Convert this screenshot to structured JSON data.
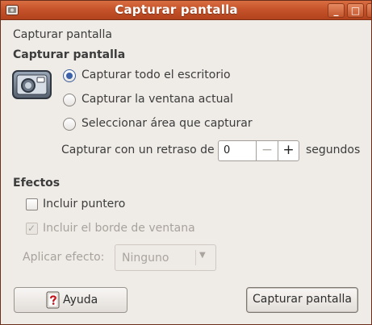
{
  "window": {
    "title": "Capturar pantalla",
    "minimize_label": "_",
    "maximize_label": "□"
  },
  "header_caption": "Capturar pantalla",
  "capture_section": {
    "heading": "Capturar pantalla",
    "options": [
      {
        "label": "Capturar todo el escritorio",
        "checked": true
      },
      {
        "label": "Capturar la ventana actual",
        "checked": false
      },
      {
        "label": "Seleccionar área que capturar",
        "checked": false
      }
    ],
    "delay_label": "Capturar con un retraso de",
    "delay_value": "0",
    "delay_unit": "segundos",
    "minus_label": "−",
    "plus_label": "+"
  },
  "effects_section": {
    "heading": "Efectos",
    "include_pointer": {
      "label": "Incluir puntero",
      "checked": false
    },
    "include_border": {
      "label": "Incluir el borde de ventana",
      "checked": true,
      "disabled": true
    },
    "apply_effect_label": "Aplicar efecto:",
    "apply_effect_value": "Ninguno"
  },
  "buttons": {
    "help_label": "Ayuda",
    "capture_label": "Capturar pantalla"
  },
  "colors": {
    "titlebar": "#c6532a",
    "radio_accent": "#3b62a8",
    "background": "#efebe7"
  }
}
